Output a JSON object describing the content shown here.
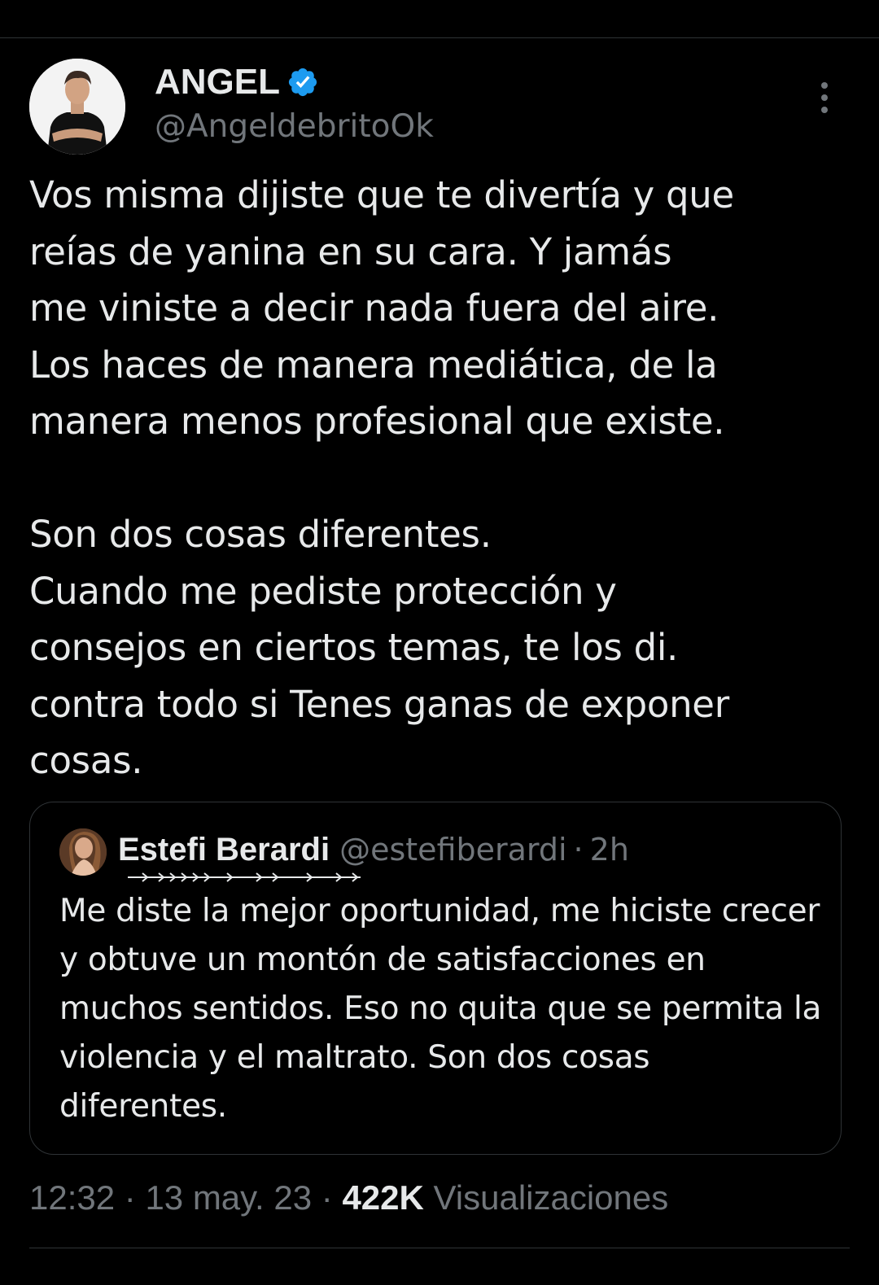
{
  "tweet": {
    "author": {
      "name": "ANGEL",
      "handle": "@AngeldebritoOk",
      "verified": true,
      "verified_color": "#1d9bf0"
    },
    "text": "Vos misma dijiste que te divertía y que\nreías de yanina en su cara. Y jamás\nme viniste a decir nada fuera del aire.\nLos haces de manera mediática, de la\nmanera menos profesional que existe.\n\nSon dos cosas diferentes.\nCuando me pediste protección y\nconsejos en ciertos temas, te los di.\ncontra todo si Tenes ganas de exponer\ncosas.",
    "quoted": {
      "name": "Estefi Berardi",
      "handle": "@estefiberardi",
      "separator": "·",
      "time": "2h",
      "text": "Me diste la mejor oportunidad, me hiciste crecer y obtuve un montón de satisfacciones en muchos sentidos. Eso no quita que se permita la violencia y el maltrato. Son dos cosas diferentes."
    },
    "meta": {
      "time": "12:32",
      "sep1": " · ",
      "date": "13 may. 23",
      "sep2": " · ",
      "views_count": "422K",
      "views_label": " Visualizaciones"
    }
  },
  "colors": {
    "background": "#000000",
    "text_primary": "#e7e9ea",
    "text_secondary": "#71767b",
    "border": "#2f3336",
    "accent": "#1d9bf0"
  },
  "icons": {
    "more": "more-vertical-icon",
    "verified": "verified-badge-icon"
  }
}
